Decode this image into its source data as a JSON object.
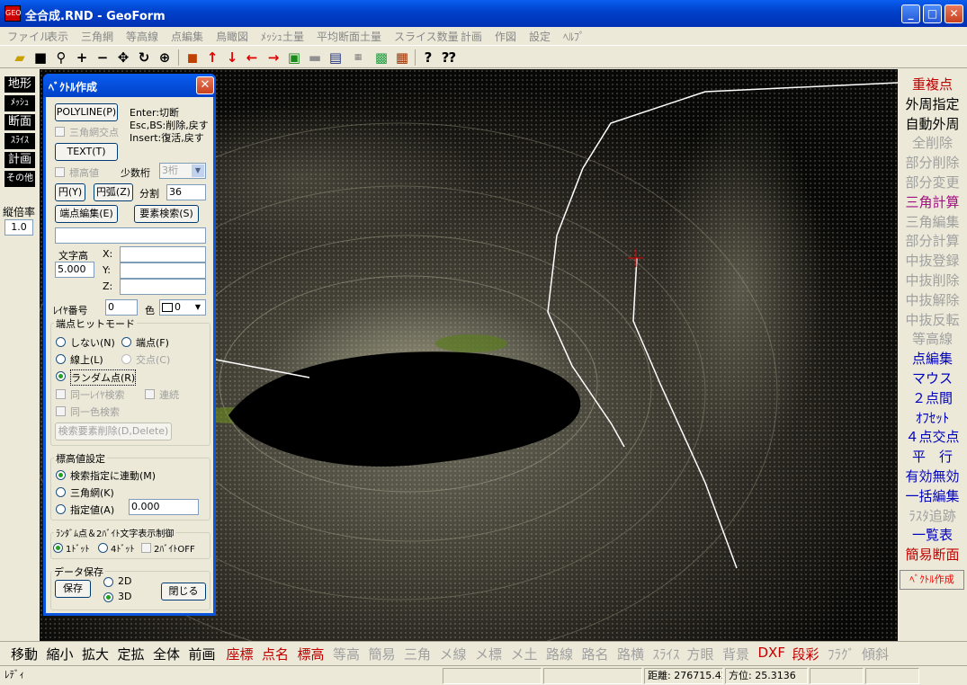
{
  "window": {
    "title": "全合成.RND - GeoForm",
    "app_icon": "GEO"
  },
  "menu": [
    "ファイル",
    "表示",
    "三角網",
    "等高線",
    "点編集",
    "鳥瞰図",
    "ﾒｯｼｭ土量",
    "平均断面土量",
    "スライス数量",
    "計画",
    "作図",
    "設定",
    "ﾍﾙﾌﾟ"
  ],
  "toolbar_icons": [
    "open-folder-icon",
    "save-disk-icon",
    "zoom-magnifier-icon",
    "plus-icon",
    "minus-icon",
    "move-cross-icon",
    "rotate-icon",
    "zoom-area-icon",
    "cube-icon",
    "arrow-up-icon",
    "arrow-down-icon",
    "arrow-left-icon",
    "arrow-right-icon",
    "box-3d-icon",
    "machine-icon",
    "window-icon",
    "sheet-icon",
    "map-icon",
    "grid-icon",
    "help-icon",
    "context-help-icon"
  ],
  "left_panel": {
    "buttons": [
      "地形",
      "ﾒｯｼｭ",
      "断面",
      "ｽﾗｲｽ",
      "計画",
      "その他"
    ],
    "scale_label": "縦倍率",
    "scale_value": "1.0"
  },
  "right_panel": {
    "items": [
      {
        "label": "重複点",
        "color": "red"
      },
      {
        "label": "外周指定",
        "color": "blk"
      },
      {
        "label": "自動外周",
        "color": "blk"
      },
      {
        "label": "全削除",
        "color": "gry"
      },
      {
        "label": "部分削除",
        "color": "gry"
      },
      {
        "label": "部分変更",
        "color": "gry"
      },
      {
        "label": "三角計算",
        "color": "pur"
      },
      {
        "label": "三角編集",
        "color": "gry"
      },
      {
        "label": "部分計算",
        "color": "gry"
      },
      {
        "label": "中抜登録",
        "color": "gry"
      },
      {
        "label": "中抜削除",
        "color": "gry"
      },
      {
        "label": "中抜解除",
        "color": "gry"
      },
      {
        "label": "中抜反転",
        "color": "gry"
      },
      {
        "label": "等高線",
        "color": "gry"
      },
      {
        "label": "点編集",
        "color": "blu"
      },
      {
        "label": "マウス",
        "color": "blu"
      },
      {
        "label": "２点間",
        "color": "blu"
      },
      {
        "label": "ｵﾌｾｯﾄ",
        "color": "blu"
      },
      {
        "label": "４点交点",
        "color": "blu"
      },
      {
        "label": "平　行",
        "color": "blu"
      },
      {
        "label": "有効無効",
        "color": "blu"
      },
      {
        "label": "一括編集",
        "color": "blu"
      },
      {
        "label": "ﾗｽﾀ追跡",
        "color": "gry"
      },
      {
        "label": "一覧表",
        "color": "blu"
      },
      {
        "label": "簡易断面",
        "color": "red"
      }
    ],
    "vector_create": "ﾍﾞｸﾄﾙ作成"
  },
  "bottom_bar": [
    {
      "label": "移動",
      "color": "#000"
    },
    {
      "label": "縮小",
      "color": "#000"
    },
    {
      "label": "拡大",
      "color": "#000"
    },
    {
      "label": "定拡",
      "color": "#000"
    },
    {
      "label": "全体",
      "color": "#000"
    },
    {
      "label": "前画",
      "color": "#000"
    },
    {
      "label": "座標",
      "color": "#c00000"
    },
    {
      "label": "点名",
      "color": "#c00000"
    },
    {
      "label": "標高",
      "color": "#c00000"
    },
    {
      "label": "等高",
      "color": "#a0a0a0"
    },
    {
      "label": "簡易",
      "color": "#a0a0a0"
    },
    {
      "label": "三角",
      "color": "#a0a0a0"
    },
    {
      "label": "メ線",
      "color": "#a0a0a0"
    },
    {
      "label": "メ標",
      "color": "#a0a0a0"
    },
    {
      "label": "メ土",
      "color": "#a0a0a0"
    },
    {
      "label": "路線",
      "color": "#a0a0a0"
    },
    {
      "label": "路名",
      "color": "#a0a0a0"
    },
    {
      "label": "路横",
      "color": "#a0a0a0"
    },
    {
      "label": "ｽﾗｲｽ",
      "color": "#a0a0a0"
    },
    {
      "label": "方眼",
      "color": "#a0a0a0"
    },
    {
      "label": "背景",
      "color": "#a0a0a0"
    },
    {
      "label": "DXF",
      "color": "#c00000"
    },
    {
      "label": "段彩",
      "color": "#c00000"
    },
    {
      "label": "ﾌﾗｸﾞ",
      "color": "#a0a0a0"
    },
    {
      "label": "傾斜",
      "color": "#a0a0a0"
    }
  ],
  "status": {
    "ready": "ﾚﾃﾞｨ",
    "distance": "距離: 276715.423",
    "bearing": "方位: 25.3136"
  },
  "dialog": {
    "title": "ﾍﾞｸﾄﾙ作成",
    "polyline_btn": "POLYLINE(P)",
    "help1": "Enter:切断",
    "help2": "Esc,BS:削除,戻す",
    "help3": "Insert:復活,戻す",
    "tri_cross": "三角網交点",
    "text_btn": "TEXT(T)",
    "elev_val": "標高値",
    "decimals_label": "少数桁",
    "decimals_value": "3桁",
    "circle_btn": "円(Y)",
    "arc_btn": "円弧(Z)",
    "divide_label": "分割",
    "divide_value": "36",
    "endpoint_edit_btn": "端点編集(E)",
    "element_search_btn": "要素検索(S)",
    "text_input": "",
    "char_height_label": "文字高",
    "char_height_value": "5.000",
    "x_label": "X:",
    "y_label": "Y:",
    "z_label": "Z:",
    "x_value": "",
    "y_value": "",
    "z_value": "",
    "layer_label": "ﾚｲﾔ番号",
    "layer_value": "0",
    "color_label": "色",
    "color_value": "0",
    "hit_group_title": "端点ヒットモード",
    "hit_none": "しない(N)",
    "hit_endpoint": "端点(F)",
    "hit_online": "線上(L)",
    "hit_cross": "交点(C)",
    "hit_random": "ランダム点(R)",
    "same_layer": "同一ﾚｲﾔ検索",
    "continuous": "連続",
    "same_color": "同一色検索",
    "delete_search_btn": "検索要素削除(D,Delete)",
    "elev_group_title": "標高値設定",
    "elev_link": "検索指定に連動(M)",
    "elev_tri": "三角網(K)",
    "elev_spec": "指定値(A)",
    "elev_spec_value": "0.000",
    "random_group_title": "ﾗﾝﾀﾞﾑ点＆2ﾊﾞｲﾄ文字表示制御",
    "dot1": "1ﾄﾞｯﾄ",
    "dot4": "4ﾄﾞｯﾄ",
    "byte2off": "2ﾊﾞｲﾄOFF",
    "save_group_title": "データ保存",
    "save_btn": "保存",
    "opt_2d": "2D",
    "opt_3d": "3D",
    "close_btn": "閉じる"
  }
}
